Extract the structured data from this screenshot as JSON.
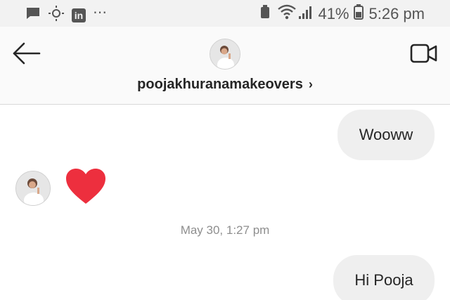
{
  "status_bar": {
    "left_icons": [
      "chat-bubble-icon",
      "brightness-icon",
      "linkedin-icon",
      "more-dots-icon"
    ],
    "linkedin_label": "in",
    "more_dots": "⋯",
    "battery_percent": "41%",
    "time": "5:26 pm"
  },
  "header": {
    "username": "poojakhuranamakeovers",
    "chevron": "›"
  },
  "chat": {
    "messages": [
      {
        "side": "right",
        "text": "Wooww"
      },
      {
        "side": "left",
        "type": "heart-reaction"
      },
      {
        "side": "right",
        "text": "Hi Pooja"
      }
    ],
    "timestamp": "May 30, 1:27 pm"
  },
  "colors": {
    "status_bar_bg": "#f2f2f2",
    "header_bg": "#fafafa",
    "bubble_bg": "#efefef",
    "heart": "#ed2f3e",
    "timestamp": "#8e8e8e"
  }
}
